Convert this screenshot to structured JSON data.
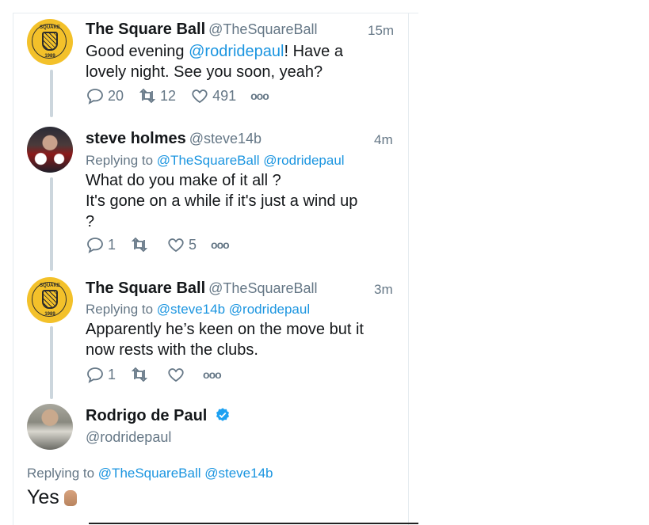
{
  "tweets": [
    {
      "name": "The Square Ball",
      "handle": "@TheSquareBall",
      "time": "15m",
      "text_prefix": "Good evening ",
      "text_mention": "@rodridepaul",
      "text_line1_suffix": "! Have a",
      "text_line2": "lovely night. See you soon, yeah?",
      "replies": "20",
      "retweets": "12",
      "likes": "491"
    },
    {
      "name": "steve holmes",
      "handle": "@steve14b",
      "time": "4m",
      "replying_label": "Replying to",
      "replying_to_1": "@TheSquareBall",
      "replying_to_2": "@rodridepaul",
      "text_line1": "What do you make of it all ?",
      "text_line2": "It's gone on a while if it's just a wind up",
      "text_line3": "?",
      "replies": "1",
      "retweets": "",
      "likes": "5"
    },
    {
      "name": "The Square Ball",
      "handle": "@TheSquareBall",
      "time": "3m",
      "replying_label": "Replying to",
      "replying_to_1": "@steve14b",
      "replying_to_2": "@rodridepaul",
      "text_line1": "Apparently he’s keen on the move but it",
      "text_line2": "now rests with the clubs.",
      "replies": "1",
      "retweets": "",
      "likes": ""
    }
  ],
  "main_tweet": {
    "name": "Rodrigo de Paul",
    "handle": "@rodridepaul",
    "replying_label": "Replying to",
    "replying_to_1": "@TheSquareBall",
    "replying_to_2": "@steve14b",
    "text": "Yes"
  },
  "avatar_text": {
    "top": "SQUARE",
    "left": "THE",
    "right": "BALL",
    "bottom": "1989"
  },
  "colors": {
    "link": "#1b95e0",
    "muted": "#657786",
    "thread_line": "#ccd6dd",
    "avatar_yellow": "#f3c12a"
  },
  "icons": [
    "reply-icon",
    "retweet-icon",
    "like-icon",
    "more-icon",
    "verified-badge-icon"
  ]
}
